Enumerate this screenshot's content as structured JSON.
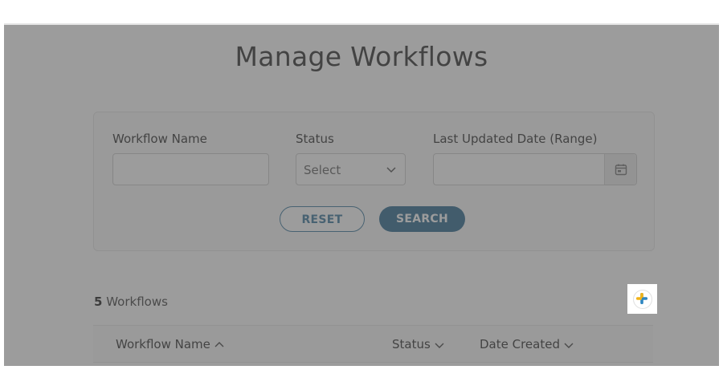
{
  "page": {
    "title": "Manage Workflows"
  },
  "filters": {
    "workflow_name": {
      "label": "Workflow Name",
      "value": "",
      "placeholder": ""
    },
    "status": {
      "label": "Status",
      "selected": "Select"
    },
    "last_updated": {
      "label": "Last Updated Date (Range)",
      "value": ""
    },
    "reset_label": "RESET",
    "search_label": "SEARCH"
  },
  "results": {
    "count": "5",
    "count_suffix": " Workflows"
  },
  "table": {
    "columns": [
      {
        "label": "Workflow Name",
        "sort": "asc"
      },
      {
        "label": "Status",
        "sort": "none"
      },
      {
        "label": "Date Created",
        "sort": "none"
      }
    ]
  },
  "icons": {
    "calendar": "calendar-icon",
    "chevron": "chevron-down-icon",
    "add": "plus-icon"
  },
  "colors": {
    "primary": "#1f5f88",
    "overlay": "#5a5a5a",
    "plus_blue": "#2e86c1",
    "plus_yellow": "#f2b318"
  }
}
